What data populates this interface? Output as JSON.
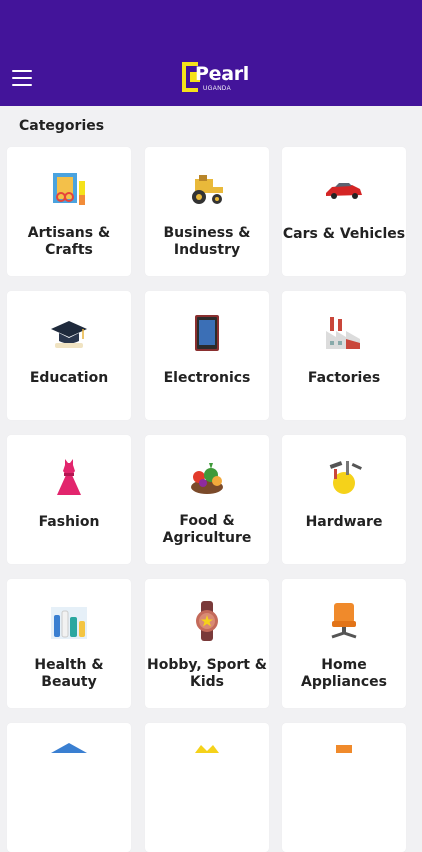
{
  "app": {
    "logo_text": "Pearl",
    "logo_subtext": "UGANDA"
  },
  "section": {
    "title": "Categories"
  },
  "categories": [
    {
      "label": "Artisans & Crafts",
      "icon": "palette-brush-icon"
    },
    {
      "label": "Business & Industry",
      "icon": "tractor-icon"
    },
    {
      "label": "Cars & Vehicles",
      "icon": "red-car-icon"
    },
    {
      "label": "Education",
      "icon": "graduation-cap-icon"
    },
    {
      "label": "Electronics",
      "icon": "tablet-icon"
    },
    {
      "label": "Factories",
      "icon": "factory-icon"
    },
    {
      "label": "Fashion",
      "icon": "dress-icon"
    },
    {
      "label": "Food & Agriculture",
      "icon": "vegetables-icon"
    },
    {
      "label": "Hardware",
      "icon": "tools-icon"
    },
    {
      "label": "Health & Beauty",
      "icon": "beauty-products-icon"
    },
    {
      "label": "Hobby, Sport & Kids",
      "icon": "watch-icon"
    },
    {
      "label": "Home Appliances",
      "icon": "chair-icon"
    }
  ],
  "colors": {
    "header": "#43149a",
    "logo_yellow": "#f5e21a",
    "background": "#f1f1f3"
  }
}
